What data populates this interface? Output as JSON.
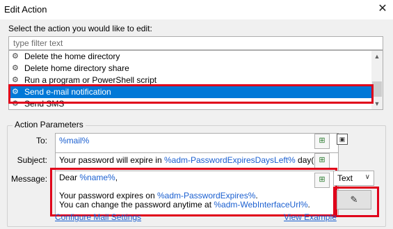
{
  "window": {
    "title": "Edit Action",
    "close_glyph": "✕"
  },
  "selector": {
    "prompt": "Select the action you would like to edit:",
    "filter_placeholder": "type filter text",
    "items": [
      {
        "label": "Delete the home directory",
        "selected": false
      },
      {
        "label": "Delete home directory share",
        "selected": false
      },
      {
        "label": "Run a program or PowerShell script",
        "selected": false
      },
      {
        "label": "Send e-mail notification",
        "selected": true
      },
      {
        "label": "Send SMS",
        "selected": false
      }
    ],
    "item_icon": "gear-icon"
  },
  "parameters": {
    "group_label": "Action Parameters",
    "to": {
      "label": "To:",
      "value": "%mail%"
    },
    "subject": {
      "label": "Subject:",
      "prefix": "Your password will expire in ",
      "variable": "%adm-PasswordExpiresDaysLeft%",
      "suffix": " day(s)"
    },
    "message": {
      "label": "Message:",
      "line1_prefix": "Dear ",
      "line1_var": "%name%",
      "line1_suffix": ",",
      "line2_prefix": "Your password expires on ",
      "line2_var": "%adm-PasswordExpires%",
      "line2_suffix": ".",
      "line3_prefix": "You can change the password anytime at ",
      "line3_var": "%adm-WebInterfaceUrl%",
      "line3_suffix": "."
    },
    "format": {
      "selected": "Text"
    },
    "links": {
      "configure": "Configure Mail Settings",
      "example": "View Example"
    }
  },
  "icons": {
    "insert": "insert-variable-icon",
    "address_book": "address-book-icon",
    "edit": "edit-pencil-icon"
  }
}
